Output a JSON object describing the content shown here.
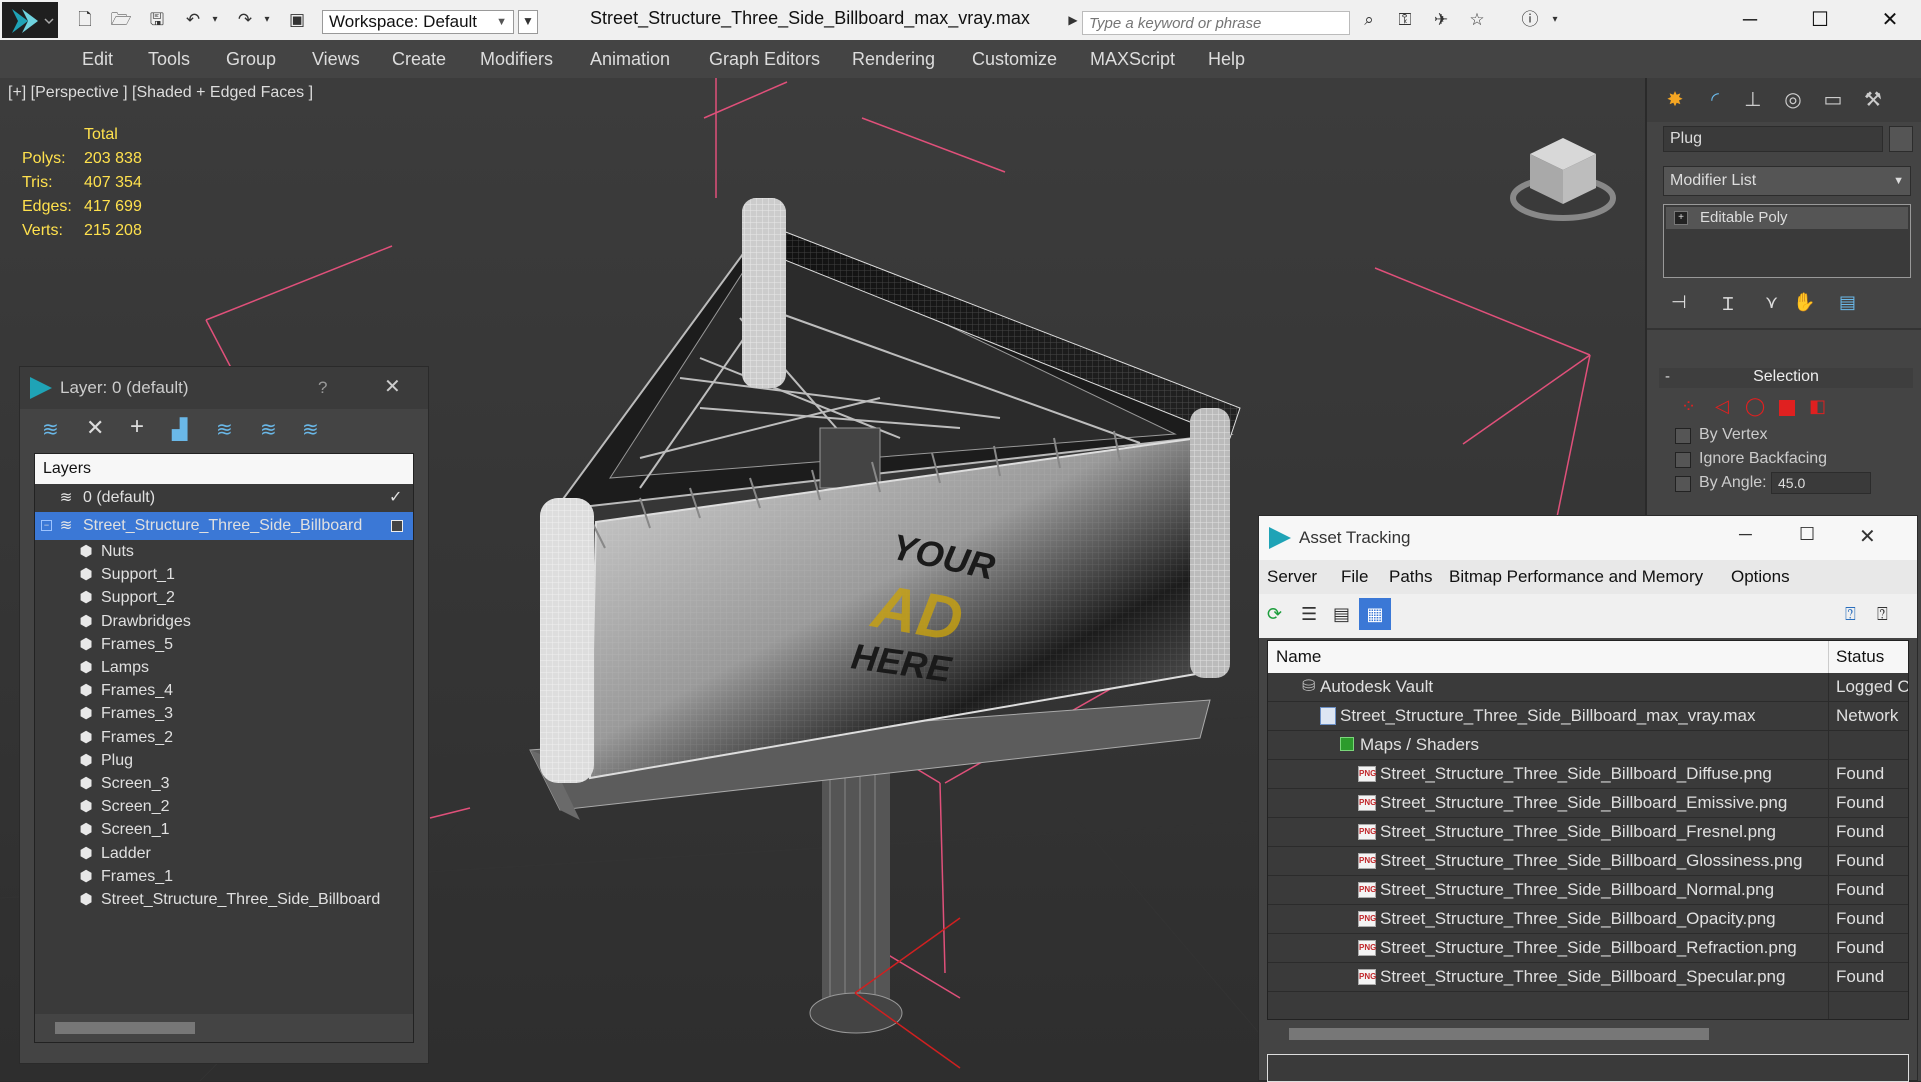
{
  "titlebar": {
    "workspace_label": "Workspace: Default",
    "doc_title": "Street_Structure_Three_Side_Billboard_max_vray.max",
    "search_placeholder": "Type a keyword or phrase"
  },
  "menu": [
    "Edit",
    "Tools",
    "Group",
    "Views",
    "Create",
    "Modifiers",
    "Animation",
    "Graph Editors",
    "Rendering",
    "Customize",
    "MAXScript",
    "Help"
  ],
  "viewport": {
    "label": "[+] [Perspective ] [Shaded + Edged Faces ]",
    "stats_header": "Total",
    "stats": [
      {
        "label": "Polys:",
        "value": "203 838"
      },
      {
        "label": "Tris:",
        "value": "407 354"
      },
      {
        "label": "Edges:",
        "value": "417 699"
      },
      {
        "label": "Verts:",
        "value": "215 208"
      }
    ],
    "billboard_text": [
      "YOUR",
      "AD",
      "HERE"
    ]
  },
  "command_panel": {
    "object_name": "Plug",
    "modifier_list": "Modifier List",
    "stack_item": "Editable Poly",
    "rollout_title": "Selection",
    "rollout_minus": "-",
    "by_vertex": "By Vertex",
    "ignore_backfacing": "Ignore Backfacing",
    "by_angle": "By Angle:",
    "angle_value": "45.0"
  },
  "layer_window": {
    "title": "Layer: 0 (default)",
    "help": "?",
    "column": "Layers",
    "default_layer": "0 (default)",
    "selected_layer": "Street_Structure_Three_Side_Billboard",
    "objects": [
      "Nuts",
      "Support_1",
      "Support_2",
      "Drawbridges",
      "Frames_5",
      "Lamps",
      "Frames_4",
      "Frames_3",
      "Frames_2",
      "Plug",
      "Screen_3",
      "Screen_2",
      "Screen_1",
      "Ladder",
      "Frames_1",
      "Street_Structure_Three_Side_Billboard"
    ]
  },
  "asset_tracking": {
    "title": "Asset Tracking",
    "menu": [
      "Server",
      "File",
      "Paths",
      "Bitmap Performance and Memory",
      "Options"
    ],
    "col_name": "Name",
    "col_status": "Status",
    "vault": {
      "name": "Autodesk Vault",
      "status": "Logged Out"
    },
    "max_file": {
      "name": "Street_Structure_Three_Side_Billboard_max_vray.max",
      "status": "Network"
    },
    "maps_folder": "Maps / Shaders",
    "files": [
      {
        "name": "Street_Structure_Three_Side_Billboard_Diffuse.png",
        "status": "Found"
      },
      {
        "name": "Street_Structure_Three_Side_Billboard_Emissive.png",
        "status": "Found"
      },
      {
        "name": "Street_Structure_Three_Side_Billboard_Fresnel.png",
        "status": "Found"
      },
      {
        "name": "Street_Structure_Three_Side_Billboard_Glossiness.png",
        "status": "Found"
      },
      {
        "name": "Street_Structure_Three_Side_Billboard_Normal.png",
        "status": "Found"
      },
      {
        "name": "Street_Structure_Three_Side_Billboard_Opacity.png",
        "status": "Found"
      },
      {
        "name": "Street_Structure_Three_Side_Billboard_Refraction.png",
        "status": "Found"
      },
      {
        "name": "Street_Structure_Three_Side_Billboard_Specular.png",
        "status": "Found"
      }
    ],
    "png_badge": "PNG"
  },
  "colors": {
    "accent": "#3b78d6",
    "stats_yellow": "#ffe14d",
    "bounds_pink": "#e0507a",
    "selection_red": "#e02020"
  }
}
